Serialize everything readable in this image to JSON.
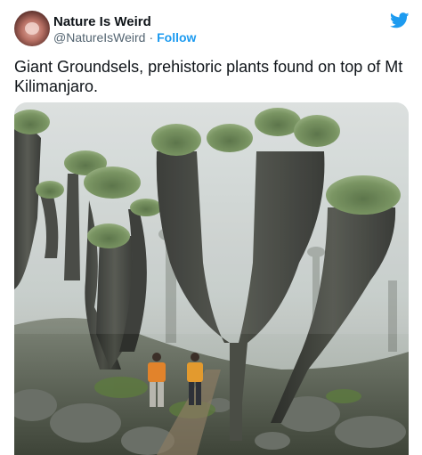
{
  "tweet": {
    "display_name": "Nature Is Weird",
    "handle": "@NatureIsWeird",
    "separator": "·",
    "follow_label": "Follow",
    "text": "Giant Groundsels, prehistoric plants found on top of Mt Kilimanjaro."
  },
  "icons": {
    "brand": "twitter-bird-icon"
  },
  "colors": {
    "accent": "#1d9bf0",
    "primary_text": "#0f1419",
    "secondary_text": "#536471"
  }
}
